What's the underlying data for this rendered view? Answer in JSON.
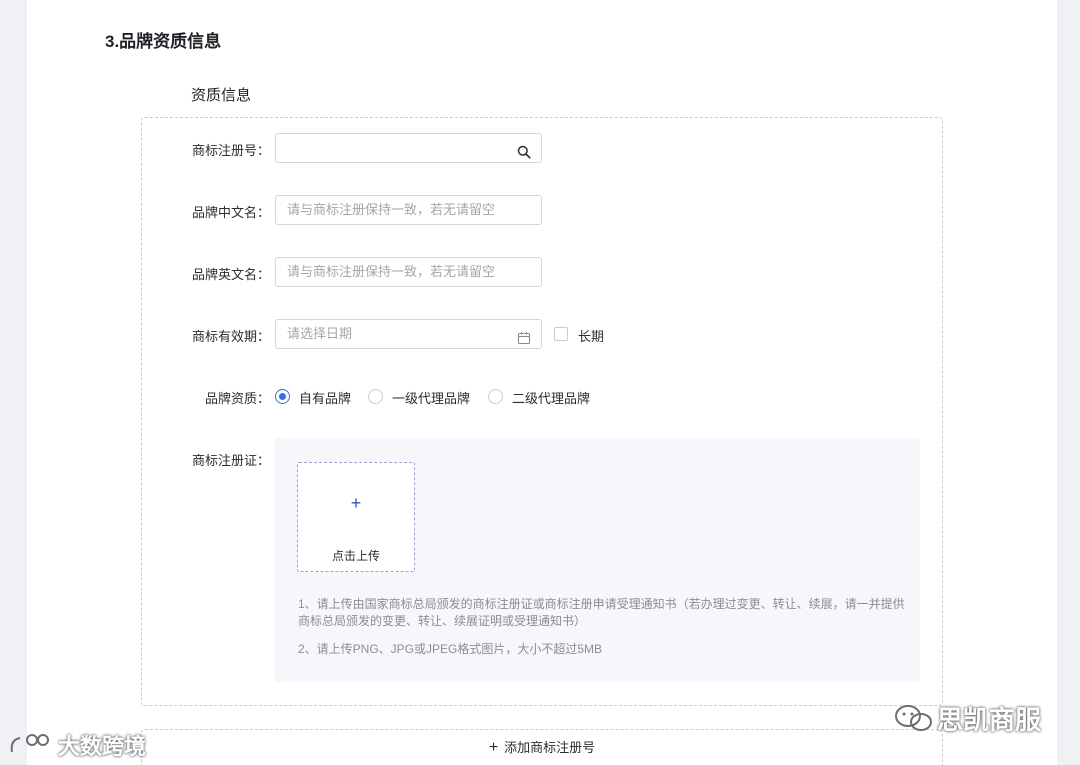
{
  "section": {
    "title": "3.品牌资质信息",
    "subtitle": "资质信息"
  },
  "form": {
    "trademark_no": {
      "label": "商标注册号：",
      "value": "",
      "icon": "search-icon"
    },
    "brand_cn": {
      "label": "品牌中文名：",
      "placeholder": "请与商标注册保持一致，若无请留空"
    },
    "brand_en": {
      "label": "品牌英文名：",
      "placeholder": "请与商标注册保持一致，若无请留空"
    },
    "validity": {
      "label": "商标有效期：",
      "placeholder": "请选择日期",
      "icon": "calendar-icon",
      "long_term_label": "长期",
      "long_term_checked": false
    },
    "qualification": {
      "label": "品牌资质：",
      "options": [
        "自有品牌",
        "一级代理品牌",
        "二级代理品牌"
      ],
      "selected": "自有品牌"
    },
    "certificate": {
      "label": "商标注册证：",
      "upload_label": "点击上传",
      "notes": [
        "1、请上传由国家商标总局颁发的商标注册证或商标注册申请受理通知书（若办理过变更、转让、续展，请一并提供商标总局颁发的变更、转让、续展证明或受理通知书）",
        "2、请上传PNG、JPG或JPEG格式图片，大小不超过5MB"
      ]
    }
  },
  "add_button": {
    "label": "添加商标注册号"
  },
  "watermarks": {
    "right": "思凯商服",
    "left": "大数跨境"
  },
  "colors": {
    "accent": "#3a6fe0",
    "border": "#d3d6dc",
    "placeholder": "#a3a6ad",
    "upload_bg": "#f7f7fb"
  }
}
